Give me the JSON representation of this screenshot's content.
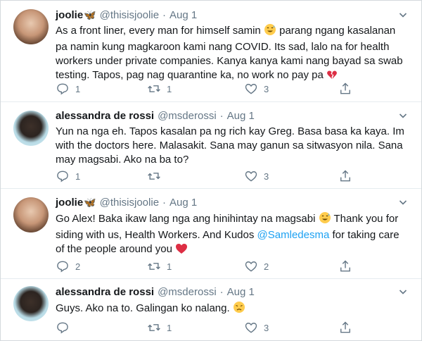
{
  "tweets": [
    {
      "name": "joolie",
      "verified_badge": "🦋",
      "handle": "@thisisjoolie",
      "separator": "·",
      "date": "Aug 1",
      "lines": [
        "As a front liner, every man for himself samin",
        "pa namin kung magkaroon kami nang COVID. Its sad, lalo na for health",
        "workers under private companies. Kanya kanya kami nang bayad sa swab",
        "testing. Tapos, pag nag quarantine ka, no work no pay pa"
      ],
      "line1_after_emoji": "parang ngang kasalanan",
      "reply_count": "1",
      "retweet_count": "1",
      "like_count": "3"
    },
    {
      "name": "alessandra de rossi",
      "handle": "@msderossi",
      "separator": "·",
      "date": "Aug 1",
      "lines": [
        "Yun na nga eh. Tapos kasalan pa ng rich kay Greg. Basa basa ka kaya. Im",
        "with the doctors here. Malasakit. Sana may ganun sa sitwasyon nila. Sana",
        "may magsabi. Ako na ba to?"
      ],
      "reply_count": "1",
      "retweet_count": "",
      "like_count": "3"
    },
    {
      "name": "joolie",
      "verified_badge": "🦋",
      "handle": "@thisisjoolie",
      "separator": "·",
      "date": "Aug 1",
      "line1_before_emoji": "Go Alex! Baka ikaw lang nga ang hinihintay na magsabi",
      "line1_after_emoji": "Thank you for",
      "line2_before_mention": "siding with us, Health Workers. And Kudos",
      "mention": "@Samledesma",
      "line2_after_mention": "for taking care",
      "line3": "of the people around you",
      "reply_count": "2",
      "retweet_count": "1",
      "like_count": "2"
    },
    {
      "name": "alessandra de rossi",
      "handle": "@msderossi",
      "separator": "·",
      "date": "Aug 1",
      "line1": "Guys. Ako na to. Galingan ko nalang.",
      "reply_count": "",
      "retweet_count": "1",
      "like_count": "3"
    }
  ],
  "icons": {
    "reply": "reply-icon",
    "retweet": "retweet-icon",
    "like": "like-icon",
    "share": "share-icon",
    "caret": "chevron-down-icon"
  },
  "colors": {
    "text": "#14171a",
    "muted": "#657786",
    "link": "#1da1f2",
    "divider": "#e6ecf0",
    "heart": "#e0245e"
  }
}
